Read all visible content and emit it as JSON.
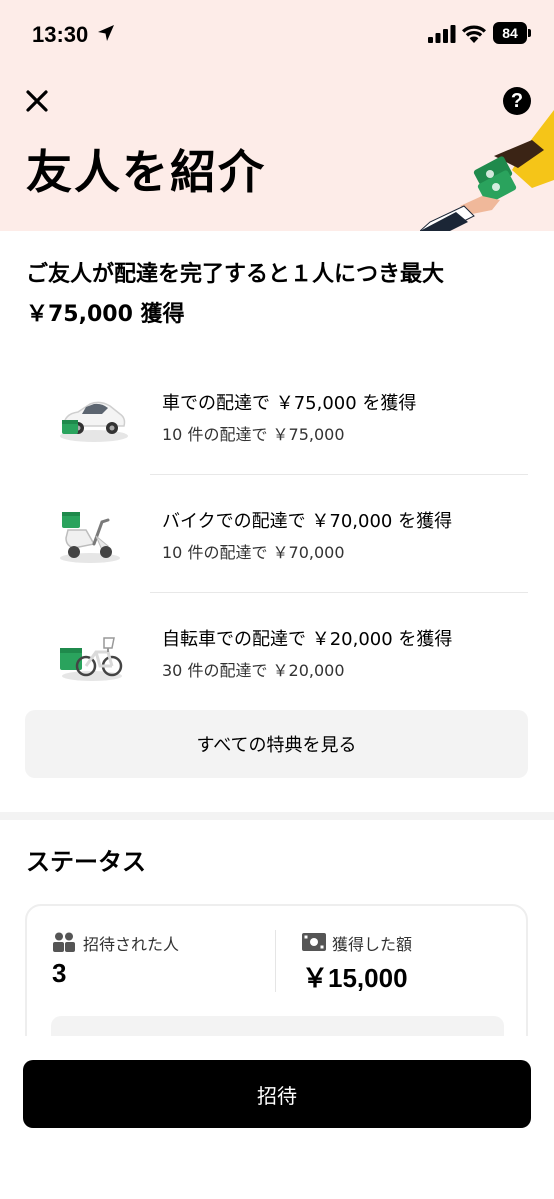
{
  "status_bar": {
    "time": "13:30",
    "battery": "84"
  },
  "header": {
    "title": "友人を紹介"
  },
  "headline": "ご友人が配達を完了すると１人につき最大 ￥75,000 獲得",
  "rewards": [
    {
      "icon": "car-icon",
      "title": "車での配達で ￥75,000 を獲得",
      "subtitle": "10 件の配達で ￥75,000"
    },
    {
      "icon": "scooter-icon",
      "title": "バイクでの配達で ￥70,000 を獲得",
      "subtitle": "10 件の配達で ￥70,000"
    },
    {
      "icon": "bicycle-icon",
      "title": "自転車での配達で ￥20,000 を獲得",
      "subtitle": "30 件の配達で ￥20,000"
    }
  ],
  "all_benefits_label": "すべての特典を見る",
  "status": {
    "heading": "ステータス",
    "invited_label": "招待された人",
    "invited_value": "3",
    "earned_label": "獲得した額",
    "earned_value": "￥15,000"
  },
  "invite_button_label": "招待",
  "colors": {
    "header_bg": "#fdece8",
    "primary_button": "#000000",
    "secondary_button": "#f3f3f3",
    "accent_green": "#1f8a4c",
    "accent_yellow": "#f5c518"
  }
}
